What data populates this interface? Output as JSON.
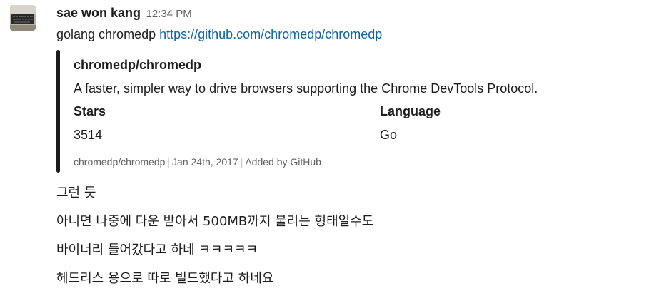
{
  "message": {
    "sender": "sae won kang",
    "timestamp": "12:34 PM",
    "text_prefix": "golang chromedp ",
    "link_text": "https://github.com/chromedp/chromedp"
  },
  "attachment": {
    "title": "chromedp/chromedp",
    "description": "A faster, simpler way to drive browsers supporting the Chrome DevTools Protocol.",
    "fields": [
      {
        "title": "Stars",
        "value": "3514"
      },
      {
        "title": "Language",
        "value": "Go"
      }
    ],
    "footer": {
      "repo": "chromedp/chromedp",
      "date": "Jan 24th, 2017",
      "added_by": "Added by GitHub"
    },
    "bar_color": "#1d1c1d"
  },
  "followups": [
    "그런 듯",
    "아니면 나중에 다운 받아서 500MB까지 불리는 형태일수도",
    "바이너리 들어갔다고 하네 ㅋㅋㅋㅋㅋ",
    "헤드리스 용으로 따로 빌드했다고 하네요"
  ],
  "colors": {
    "link": "#1264a3",
    "text": "#1d1c1d",
    "muted": "#616061"
  },
  "icons": {
    "avatar": "keyboard-photo-avatar"
  }
}
